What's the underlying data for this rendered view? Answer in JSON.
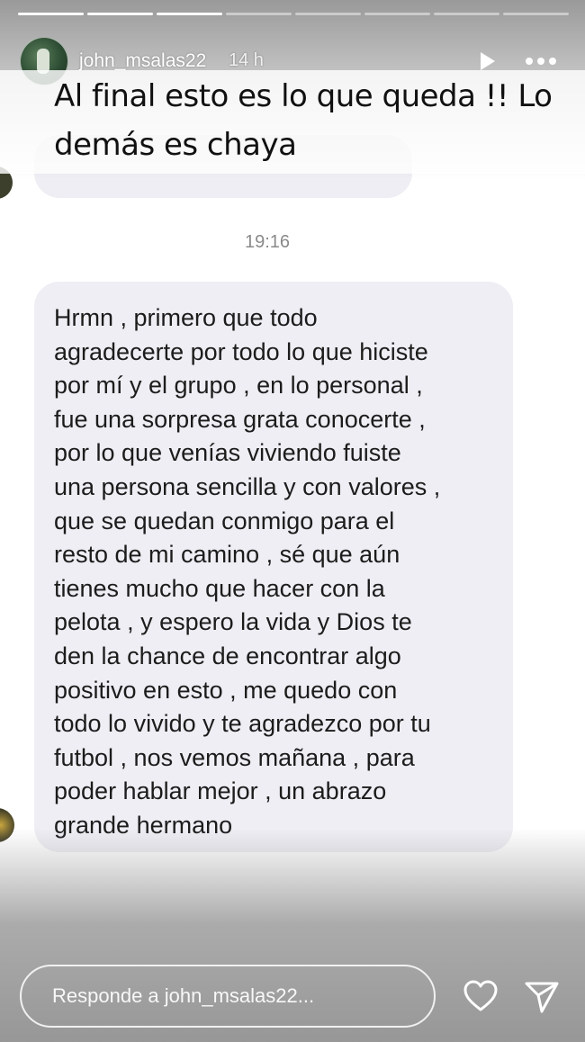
{
  "story": {
    "segments": [
      {
        "progress": 1
      },
      {
        "progress": 1
      },
      {
        "progress": 1
      },
      {
        "progress": 0
      },
      {
        "progress": 0
      },
      {
        "progress": 0
      },
      {
        "progress": 0
      },
      {
        "progress": 0
      }
    ],
    "username": "john_msalas22",
    "time": "14 h",
    "caption_line1": "Al final esto es lo que queda !! Lo",
    "caption_line2": "demás es chaya"
  },
  "chat": {
    "timestamp": "19:16",
    "message_lines": [
      "Hrmn , primero que todo",
      "agradecerte por todo lo que hiciste",
      "por mí y el grupo , en lo personal ,",
      "fue una sorpresa grata conocerte ,",
      "por lo que venías viviendo fuiste",
      "una persona sencilla y con valores ,",
      "que se quedan conmigo para el",
      "resto de mi camino , sé que aún",
      "tienes mucho que hacer con la",
      "pelota , y espero la vida y Dios te",
      "den la chance de encontrar algo",
      "positivo en esto , me quedo con",
      "todo lo vivido y te agradezco por tu",
      "futbol , nos vemos mañana , para",
      "poder hablar mejor , un abrazo",
      "grande hermano"
    ]
  },
  "reply": {
    "placeholder": "Responde a john_msalas22..."
  },
  "icons": {
    "play": "play-icon",
    "more": "more-options-icon",
    "like": "heart-icon",
    "share": "send-icon"
  }
}
